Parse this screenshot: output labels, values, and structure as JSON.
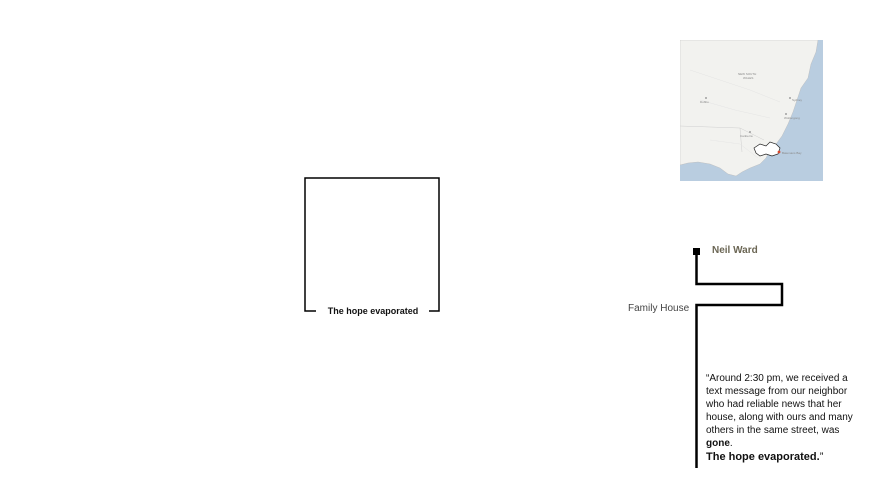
{
  "center": {
    "label": "The hope evaporated"
  },
  "map": {
    "state_label_1": "NEW SOUTH",
    "state_label_2": "WALES",
    "place_labels": [
      "Dubbo",
      "Sydney",
      "Canberra",
      "Batemans Bay",
      "Wollongong"
    ]
  },
  "diagram": {
    "person_label": "Neil Ward",
    "location_label": "Family House"
  },
  "quote": {
    "text_before": "“Around 2:30 pm, we received a text message from our neighbor who had reliable news that her house, along with ours and many others in the same street, was ",
    "bold_word": "gone",
    "period": ".",
    "closing_bold": "The hope evaporated.",
    "closing_mark": "”"
  },
  "colors": {
    "sea": "#b9cde0",
    "land": "#f2f2ef",
    "line": "#000000",
    "person_label": "#6b6654",
    "fire_marker": "#d9472b"
  }
}
